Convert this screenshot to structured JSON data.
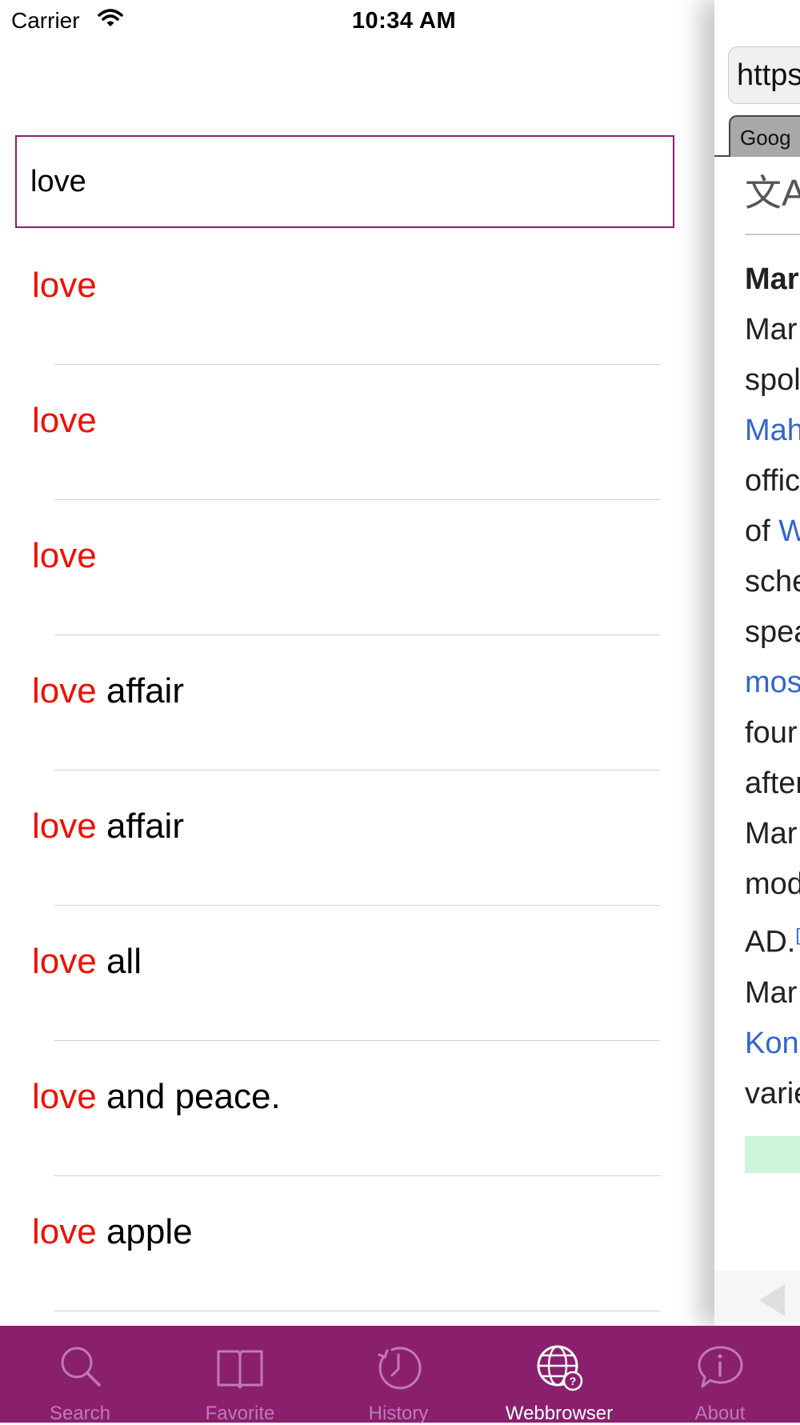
{
  "status_bar": {
    "carrier": "Carrier",
    "time": "10:34 AM"
  },
  "search": {
    "value": "love"
  },
  "results": [
    {
      "highlight": "love",
      "rest": ""
    },
    {
      "highlight": "love",
      "rest": ""
    },
    {
      "highlight": "love",
      "rest": ""
    },
    {
      "highlight": "love",
      "rest": " affair"
    },
    {
      "highlight": "love",
      "rest": " affair"
    },
    {
      "highlight": "love",
      "rest": " all"
    },
    {
      "highlight": "love",
      "rest": " and peace."
    },
    {
      "highlight": "love",
      "rest": " apple"
    }
  ],
  "web_panel": {
    "url_text": "https",
    "tab_label": "Goog",
    "translate_glyph": "文A",
    "lines": [
      {
        "text": "Mar",
        "style": "bold"
      },
      {
        "text": "Mar",
        "style": "normal"
      },
      {
        "text": "spol",
        "style": "normal"
      },
      {
        "text": "Mah",
        "style": "link"
      },
      {
        "text": "offic",
        "style": "normal"
      },
      {
        "text": "of ",
        "link_tail": "W",
        "style": "mixed"
      },
      {
        "text": "sche",
        "style": "normal"
      },
      {
        "text": "spea",
        "style": "normal"
      },
      {
        "text": "mos",
        "style": "link"
      },
      {
        "text": "four",
        "style": "normal"
      },
      {
        "text": "after",
        "style": "normal"
      },
      {
        "text": "Mar",
        "style": "normal"
      },
      {
        "text": "mod",
        "style": "normal"
      },
      {
        "text": "AD.",
        "sup": "[",
        "style": "sup"
      },
      {
        "text": "Mar",
        "style": "normal"
      },
      {
        "text": "Kon",
        "style": "link"
      },
      {
        "text": "varie",
        "style": "normal"
      }
    ]
  },
  "tab_bar": {
    "active": "Webbrowser",
    "items": [
      {
        "label": "Search",
        "icon": "search-icon"
      },
      {
        "label": "Favorite",
        "icon": "book-icon"
      },
      {
        "label": "History",
        "icon": "clock-icon"
      },
      {
        "label": "Webbrowser",
        "icon": "globe-icon"
      },
      {
        "label": "About",
        "icon": "info-bubble-icon"
      }
    ],
    "colors": {
      "background": "#8a1f6e",
      "inactive": "#c07bb2",
      "active": "#ffffff"
    }
  },
  "colors": {
    "highlight": "#ee1100",
    "search_border": "#8a1f71",
    "link": "#3366cc"
  }
}
